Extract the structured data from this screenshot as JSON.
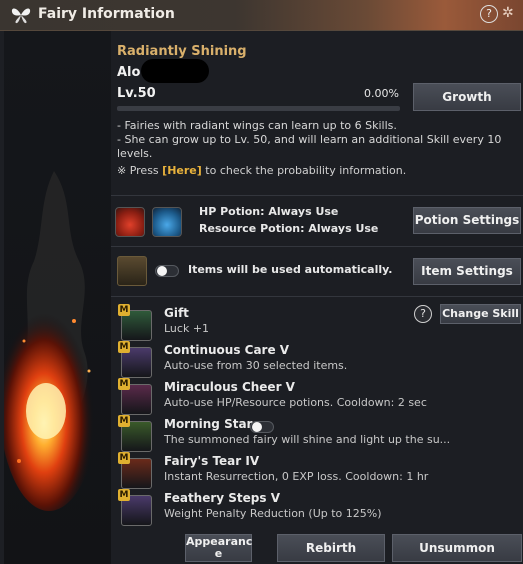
{
  "window": {
    "title": "Fairy Information",
    "icon": "butterfly-icon"
  },
  "header_controls": {
    "help": "?",
    "settings_icon": "gear-icon"
  },
  "fairy": {
    "title": "Radiantly Shining",
    "name_visible": "Alo",
    "level": "Lv.50",
    "exp_percent": "0.00%",
    "exp_fraction": 0
  },
  "growth_button": "Growth",
  "info": {
    "line1": "- Fairies with radiant wings can learn up to 6 Skills.",
    "line2": "- She can grow up to Lv. 50, and will learn an additional Skill every 10 levels.",
    "press_prefix": "※ Press ",
    "press_link": "[Here]",
    "press_suffix": " to check the probability information."
  },
  "potions": {
    "hp": "HP Potion: Always Use",
    "resource": "Resource Potion: Always Use",
    "button": "Potion Settings"
  },
  "items": {
    "text": "Items will be used automatically.",
    "button": "Item Settings",
    "toggle_on": false
  },
  "skills_header": {
    "change_button": "Change Skill",
    "help": "?"
  },
  "skills": [
    {
      "badge": "M",
      "name": "Gift",
      "desc": "Luck +1",
      "icon": "clover-icon",
      "color": "#2f5a3a"
    },
    {
      "badge": "M",
      "name": "Continuous Care V",
      "desc": "Auto-use from 30 selected items.",
      "icon": "fairy-icon",
      "color": "#4a3a6a"
    },
    {
      "badge": "M",
      "name": "Miraculous Cheer V",
      "desc": "Auto-use HP/Resource potions. Cooldown: 2 sec",
      "icon": "potion-icon",
      "color": "#5a2a4a"
    },
    {
      "badge": "M",
      "name": "Morning Star",
      "desc": "The summoned fairy will shine and light up the su...",
      "icon": "lantern-icon",
      "color": "#3a5a2a",
      "toggle_on": false
    },
    {
      "badge": "M",
      "name": "Fairy's Tear IV",
      "desc": "Instant Resurrection, 0 EXP loss. Cooldown: 1 hr",
      "icon": "tear-bottle-icon",
      "color": "#6a2a1a"
    },
    {
      "badge": "M",
      "name": "Feathery Steps V",
      "desc": "Weight Penalty Reduction (Up to 125%)",
      "icon": "boot-icon",
      "color": "#4a3a6a"
    }
  ],
  "footer": {
    "appearance_line1": "Appearanc",
    "appearance_line2": "e",
    "rebirth": "Rebirth",
    "unsummon": "Unsummon"
  }
}
